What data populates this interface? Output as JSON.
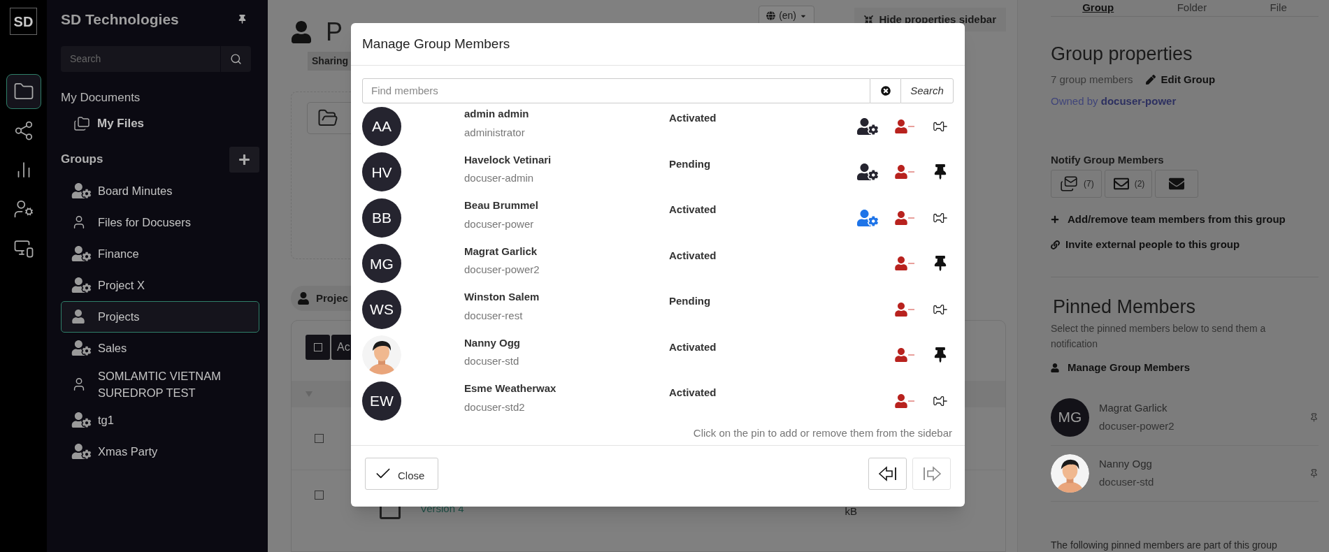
{
  "rail": {
    "logo": "SD",
    "items": [
      {
        "selected": true
      },
      {
        "selected": false
      },
      {
        "selected": false
      },
      {
        "selected": false
      },
      {
        "selected": false
      }
    ]
  },
  "sidebar": {
    "title": "SD Technologies",
    "search_placeholder": "Search",
    "section": "My Documents",
    "my_files": "My Files",
    "groups_heading": "Groups",
    "groups": [
      {
        "label": "Board Minutes",
        "kind": "managed",
        "selected": false
      },
      {
        "label": "Files for Docusers",
        "kind": "member",
        "selected": false
      },
      {
        "label": "Finance",
        "kind": "managed",
        "selected": false
      },
      {
        "label": "Project X",
        "kind": "managed",
        "selected": false
      },
      {
        "label": "Projects",
        "kind": "current",
        "selected": true
      },
      {
        "label": "Sales",
        "kind": "managed",
        "selected": false
      },
      {
        "label": "SOMLAMTIC VIETNAM SUREDROP TEST",
        "kind": "member",
        "selected": false
      },
      {
        "label": "tg1",
        "kind": "managed",
        "selected": false
      },
      {
        "label": "Xmas Party",
        "kind": "managed",
        "selected": false
      }
    ]
  },
  "page": {
    "title": "P",
    "tag": "Sharing",
    "language": "(en)",
    "hide_sidebar": "Hide properties sidebar",
    "group_chip": "Projec",
    "select_all": {
      "checked": false
    },
    "action_button": "Ac",
    "rows": [
      {
        "checked": false
      },
      {
        "checked": false
      }
    ],
    "row_version": "Version 4",
    "row_size": "kB"
  },
  "modal": {
    "title": "Manage Group Members",
    "search_placeholder": "Find members",
    "search_button": "Search",
    "members": [
      {
        "avatar": {
          "kind": "initials",
          "text": "AA"
        },
        "name": "admin admin",
        "username": "administrator",
        "status": "Activated",
        "kind": "manager",
        "pinned": false
      },
      {
        "avatar": {
          "kind": "initials",
          "text": "HV"
        },
        "name": "Havelock Vetinari",
        "username": "docuser-admin",
        "status": "Pending",
        "kind": "manager",
        "pinned": true
      },
      {
        "avatar": {
          "kind": "initials",
          "text": "BB"
        },
        "name": "Beau Brummel",
        "username": "docuser-power",
        "status": "Activated",
        "kind": "owner",
        "pinned": false
      },
      {
        "avatar": {
          "kind": "initials",
          "text": "MG"
        },
        "name": "Magrat Garlick",
        "username": "docuser-power2",
        "status": "Activated",
        "kind": "member",
        "pinned": true
      },
      {
        "avatar": {
          "kind": "initials",
          "text": "WS"
        },
        "name": "Winston Salem",
        "username": "docuser-rest",
        "status": "Pending",
        "kind": "member",
        "pinned": false
      },
      {
        "name": "Nanny Ogg",
        "username": "docuser-std",
        "status": "Activated",
        "kind": "member",
        "pinned": true
      },
      {
        "avatar": {
          "kind": "initials",
          "text": "EW"
        },
        "name": "Esme Weatherwax",
        "username": "docuser-std2",
        "status": "Activated",
        "kind": "member",
        "pinned": false
      }
    ],
    "hint": "Click on the pin to add or remove them from the sidebar",
    "close_button": "Close"
  },
  "properties": {
    "tabs": [
      {
        "label": "Group",
        "selected": true
      },
      {
        "label": "Folder",
        "selected": false
      },
      {
        "label": "File",
        "selected": false
      }
    ],
    "heading": "Group properties",
    "member_count": "7 group members",
    "edit_link": "Edit Group",
    "owned_by": "Owned by **docuser-power**",
    "notify_heading": "Notify Group Members",
    "notify_buttons": [
      {
        "kind": "all",
        "count": "(7)"
      },
      {
        "kind": "pinned",
        "count": "(2)"
      },
      {
        "kind": "custom"
      }
    ],
    "add_link": "Add/remove team members from this group",
    "invite_link": "Invite external people to this group",
    "pinned_heading": "Pinned Members",
    "pinned_description": "Select the pinned members below to send them a notification",
    "manage_link": "Manage Group Members",
    "pinned_members": [
      {
        "avatar": {
          "kind": "initials",
          "text": "MG"
        },
        "name": "Magrat Garlick",
        "username": "docuser-power2"
      },
      {
        "name": "Nanny Ogg",
        "username": "docuser-std"
      }
    ],
    "footer_text": "The following pinned members are part of this group"
  }
}
